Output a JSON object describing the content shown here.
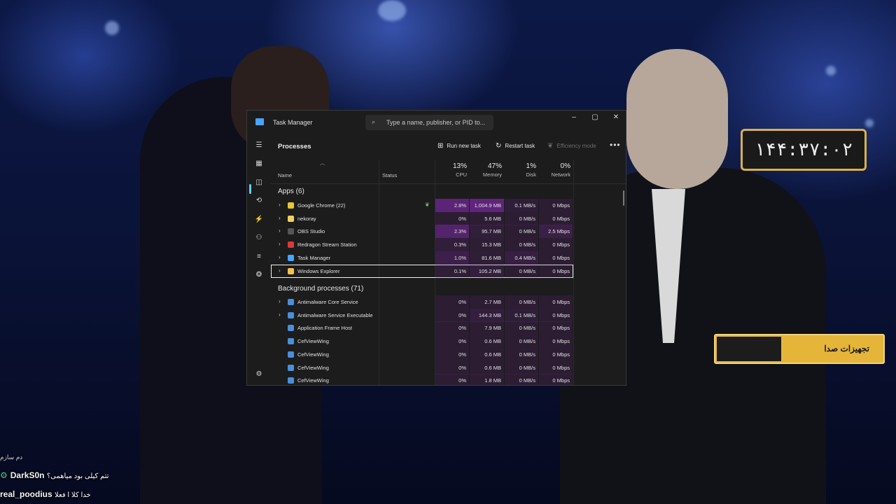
{
  "window": {
    "title": "Task Manager",
    "search_placeholder": "Type a name, publisher, or PID to..."
  },
  "toolbar": {
    "page_title": "Processes",
    "run_new_task": "Run new task",
    "restart_task": "Restart task",
    "efficiency_mode": "Efficiency mode",
    "more": "•••"
  },
  "columns": {
    "name": "Name",
    "status": "Status",
    "cpu": {
      "pct": "13%",
      "label": "CPU"
    },
    "memory": {
      "pct": "47%",
      "label": "Memory"
    },
    "disk": {
      "pct": "1%",
      "label": "Disk"
    },
    "network": {
      "pct": "0%",
      "label": "Network"
    }
  },
  "apps": {
    "header": "Apps (6)",
    "rows": [
      {
        "name": "Google Chrome (22)",
        "cpu": "2.8%",
        "mem": "1,004.9 MB",
        "disk": "0.1 MB/s",
        "net": "0 Mbps",
        "icon": "chrome-icon",
        "color": "#e8c53a"
      },
      {
        "name": "nekoray",
        "cpu": "0%",
        "mem": "5.6 MB",
        "disk": "0 MB/s",
        "net": "0 Mbps",
        "icon": "nekoray-icon",
        "color": "#f0d060"
      },
      {
        "name": "OBS Studio",
        "cpu": "2.3%",
        "mem": "95.7 MB",
        "disk": "0 MB/s",
        "net": "2.5 Mbps",
        "icon": "obs-icon",
        "color": "#555555"
      },
      {
        "name": "Redragon Stream Station",
        "cpu": "0.3%",
        "mem": "15.3 MB",
        "disk": "0 MB/s",
        "net": "0 Mbps",
        "icon": "redragon-icon",
        "color": "#d93a3a"
      },
      {
        "name": "Task Manager",
        "cpu": "1.0%",
        "mem": "81.6 MB",
        "disk": "0.4 MB/s",
        "net": "0 Mbps",
        "icon": "task-manager-icon",
        "color": "#4aa3ff"
      },
      {
        "name": "Windows Explorer",
        "cpu": "0.1%",
        "mem": "105.2 MB",
        "disk": "0 MB/s",
        "net": "0 Mbps",
        "icon": "folder-icon",
        "color": "#f2c14e"
      }
    ]
  },
  "background": {
    "header": "Background processes (71)",
    "rows": [
      {
        "name": "Antimalware Core Service",
        "cpu": "0%",
        "mem": "2.7 MB",
        "disk": "0 MB/s",
        "net": "0 Mbps"
      },
      {
        "name": "Antimalware Service Executable",
        "cpu": "0%",
        "mem": "144.3 MB",
        "disk": "0.1 MB/s",
        "net": "0 Mbps"
      },
      {
        "name": "Application Frame Host",
        "cpu": "0%",
        "mem": "7.9 MB",
        "disk": "0 MB/s",
        "net": "0 Mbps"
      },
      {
        "name": "CefViewWing",
        "cpu": "0%",
        "mem": "0.6 MB",
        "disk": "0 MB/s",
        "net": "0 Mbps"
      },
      {
        "name": "CefViewWing",
        "cpu": "0%",
        "mem": "0.6 MB",
        "disk": "0 MB/s",
        "net": "0 Mbps"
      },
      {
        "name": "CefViewWing",
        "cpu": "0%",
        "mem": "0.6 MB",
        "disk": "0 MB/s",
        "net": "0 Mbps"
      },
      {
        "name": "CefViewWing",
        "cpu": "0%",
        "mem": "1.8 MB",
        "disk": "0 MB/s",
        "net": "0 Mbps"
      }
    ]
  },
  "overlay": {
    "timer": "۱۴۴:۳۷:۰۲",
    "donation_label": "تجهیزات صدا"
  },
  "chat": [
    {
      "badge": "",
      "user": "",
      "message": "دم سازم"
    },
    {
      "badge": "⚙",
      "user": "DarkS0n",
      "message": "تتم کیلی بود میاهمی؟"
    },
    {
      "badge": "",
      "user": "real_poodius",
      "message": "خدا کلا ا فعلا"
    }
  ]
}
